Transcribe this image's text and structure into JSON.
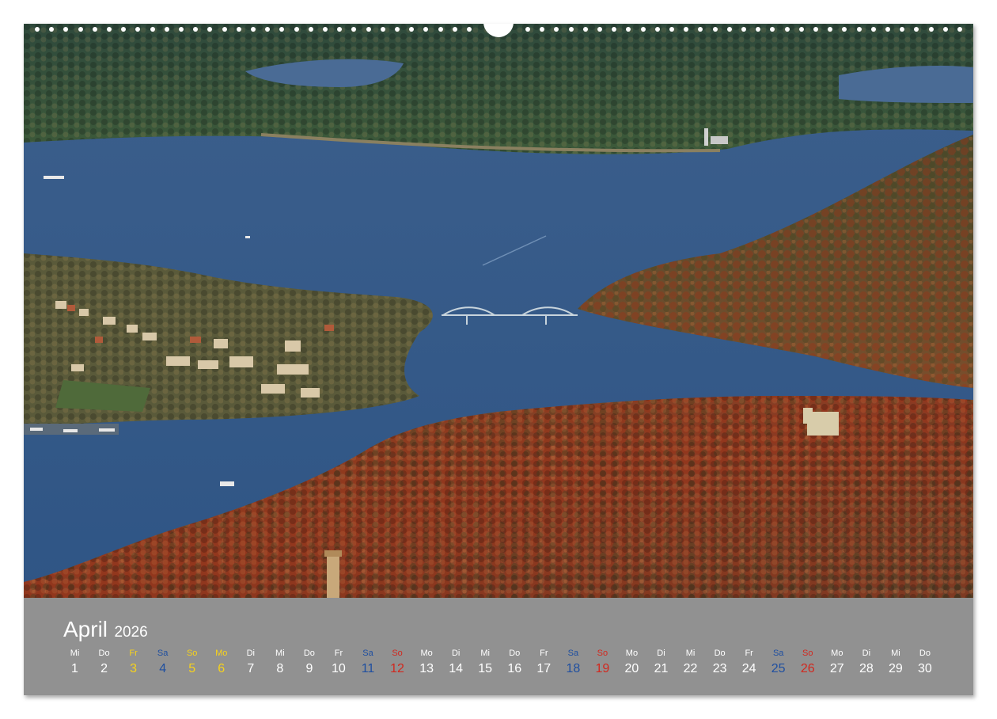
{
  "calendar": {
    "month": "April",
    "year": "2026",
    "days": [
      {
        "name": "Mi",
        "num": "1",
        "kind": "white"
      },
      {
        "name": "Do",
        "num": "2",
        "kind": "white"
      },
      {
        "name": "Fr",
        "num": "3",
        "kind": "yellow"
      },
      {
        "name": "Sa",
        "num": "4",
        "kind": "blue"
      },
      {
        "name": "So",
        "num": "5",
        "kind": "yellow"
      },
      {
        "name": "Mo",
        "num": "6",
        "kind": "yellow"
      },
      {
        "name": "Di",
        "num": "7",
        "kind": "white"
      },
      {
        "name": "Mi",
        "num": "8",
        "kind": "white"
      },
      {
        "name": "Do",
        "num": "9",
        "kind": "white"
      },
      {
        "name": "Fr",
        "num": "10",
        "kind": "white"
      },
      {
        "name": "Sa",
        "num": "11",
        "kind": "blue"
      },
      {
        "name": "So",
        "num": "12",
        "kind": "red"
      },
      {
        "name": "Mo",
        "num": "13",
        "kind": "white"
      },
      {
        "name": "Di",
        "num": "14",
        "kind": "white"
      },
      {
        "name": "Mi",
        "num": "15",
        "kind": "white"
      },
      {
        "name": "Do",
        "num": "16",
        "kind": "white"
      },
      {
        "name": "Fr",
        "num": "17",
        "kind": "white"
      },
      {
        "name": "Sa",
        "num": "18",
        "kind": "blue"
      },
      {
        "name": "So",
        "num": "19",
        "kind": "red"
      },
      {
        "name": "Mo",
        "num": "20",
        "kind": "white"
      },
      {
        "name": "Di",
        "num": "21",
        "kind": "white"
      },
      {
        "name": "Mi",
        "num": "22",
        "kind": "white"
      },
      {
        "name": "Do",
        "num": "23",
        "kind": "white"
      },
      {
        "name": "Fr",
        "num": "24",
        "kind": "white"
      },
      {
        "name": "Sa",
        "num": "25",
        "kind": "blue"
      },
      {
        "name": "So",
        "num": "26",
        "kind": "red"
      },
      {
        "name": "Mo",
        "num": "27",
        "kind": "white"
      },
      {
        "name": "Di",
        "num": "28",
        "kind": "white"
      },
      {
        "name": "Mi",
        "num": "29",
        "kind": "white"
      },
      {
        "name": "Do",
        "num": "30",
        "kind": "white"
      }
    ]
  },
  "colors": {
    "weekday": "#ffffff",
    "holiday": "#f6d21c",
    "saturday": "#1f4fa0",
    "sunday": "#d2281e",
    "footer_bg": "#919191",
    "water": "#3a5f8f"
  },
  "photo": {
    "icons": [
      "wire-binding-icon",
      "hanger-hole-icon"
    ]
  }
}
